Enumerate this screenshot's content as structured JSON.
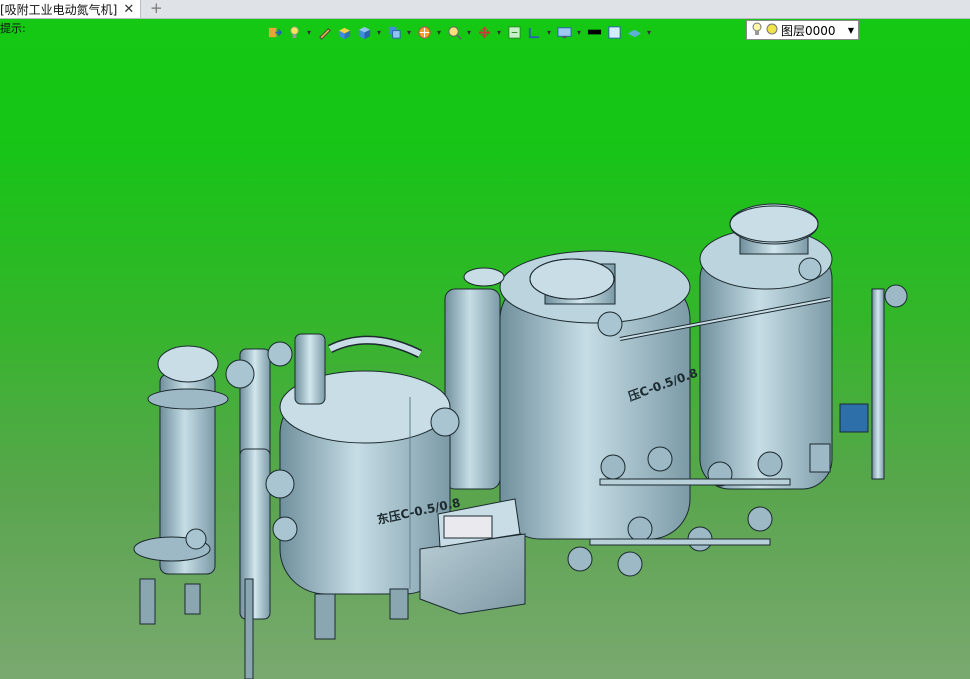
{
  "tab": {
    "title": "[吸附工业电动氮气机]",
    "close": "✕",
    "new_tab": "+"
  },
  "hint": "提示:",
  "toolbar": {
    "icons": [
      "exit-icon",
      "light-icon",
      "pencil-icon",
      "box-yellow-icon",
      "cube-blue-icon",
      "cube-stack-icon",
      "render-icon",
      "zoom-icon",
      "rotate-icon",
      "fit-icon",
      "frame-icon",
      "display-icon",
      "color-black-icon",
      "color-blue-icon",
      "layer-icon",
      "bulb-icon"
    ],
    "layer": {
      "value": "图层0000"
    }
  },
  "model": {
    "labels": [
      "东压C-0.5/0.8",
      "压C-0.5/0.8"
    ],
    "colors": {
      "metal": "#a9c5d1",
      "metal_dark": "#6d8c99",
      "edge": "#1c2a30"
    }
  }
}
